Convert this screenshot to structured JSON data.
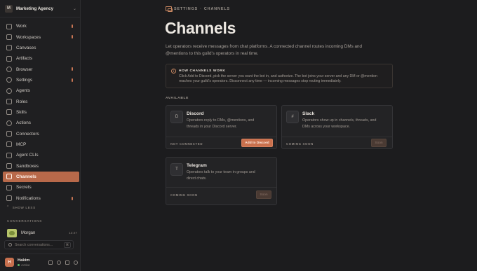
{
  "org": {
    "initial": "M",
    "name": "Marketing Agency"
  },
  "nav": {
    "items": [
      {
        "label": "Work",
        "icon": "briefcase-icon",
        "dot": true
      },
      {
        "label": "Workspaces",
        "icon": "workspaces-icon",
        "dot": true
      },
      {
        "label": "Canvases",
        "icon": "canvas-icon",
        "dot": false
      },
      {
        "label": "Artifacts",
        "icon": "artifact-icon",
        "dot": false
      },
      {
        "label": "Browser",
        "icon": "globe-icon",
        "dot": true
      },
      {
        "label": "Settings",
        "icon": "gear-icon",
        "dot": true
      },
      {
        "label": "Agents",
        "icon": "agent-icon",
        "dot": false
      },
      {
        "label": "Roles",
        "icon": "roles-icon",
        "dot": false
      },
      {
        "label": "Skills",
        "icon": "skills-icon",
        "dot": false
      },
      {
        "label": "Actions",
        "icon": "actions-icon",
        "dot": false
      },
      {
        "label": "Connectors",
        "icon": "connector-icon",
        "dot": false
      },
      {
        "label": "MCP",
        "icon": "mcp-icon",
        "dot": false
      },
      {
        "label": "Agent CLIs",
        "icon": "terminal-icon",
        "dot": false
      },
      {
        "label": "Sandboxes",
        "icon": "sandbox-icon",
        "dot": false
      },
      {
        "label": "Channels",
        "icon": "channels-icon",
        "dot": false,
        "active": true
      },
      {
        "label": "Secrets",
        "icon": "key-icon",
        "dot": false
      },
      {
        "label": "Notifications",
        "icon": "bell-icon",
        "dot": true
      }
    ],
    "show_less": "SHOW LESS"
  },
  "conversations": {
    "heading": "CONVERSATIONS",
    "items": [
      {
        "name": "Morgan",
        "time": "13:47"
      }
    ],
    "search_placeholder": "Search conversations...",
    "search_shortcut": "⌘"
  },
  "user": {
    "initial": "H",
    "name": "Hakim",
    "status": "Active"
  },
  "header": {
    "breadcrumb_parent": "SETTINGS",
    "breadcrumb_sep": "·",
    "breadcrumb_current": "CHANNELS",
    "title": "Channels",
    "description": "Let operators receive messages from chat platforms. A connected channel routes incoming DMs and @mentions to this guild's operators in real time."
  },
  "callout": {
    "icon": "i",
    "title": "HOW CHANNELS WORK",
    "text": "Click Add to Discord, pick the server you want the bot in, and authorize. The bot joins your server and any DM or @mention reaches your guild's operators. Disconnect any time — incoming messages stop routing immediately."
  },
  "section_label": "AVAILABLE",
  "channels": [
    {
      "name": "Discord",
      "glyph": "D",
      "description": "Operators reply to DMs, @mentions, and threads in your Discord server.",
      "status": "NOT CONNECTED",
      "button": "Add to Discord"
    },
    {
      "name": "Slack",
      "glyph": "#",
      "description": "Operators show up in channels, threads, and DMs across your workspace.",
      "status": "COMING SOON",
      "button": "Soon"
    },
    {
      "name": "Telegram",
      "glyph": "T",
      "description": "Operators talk to your team in groups and direct chats.",
      "status": "COMING SOON",
      "button": "Soon"
    }
  ],
  "colors": {
    "accent": "#c9704d",
    "active_nav": "#b8694a",
    "background": "#1c1c1e",
    "status_active": "#5fbf6d"
  }
}
